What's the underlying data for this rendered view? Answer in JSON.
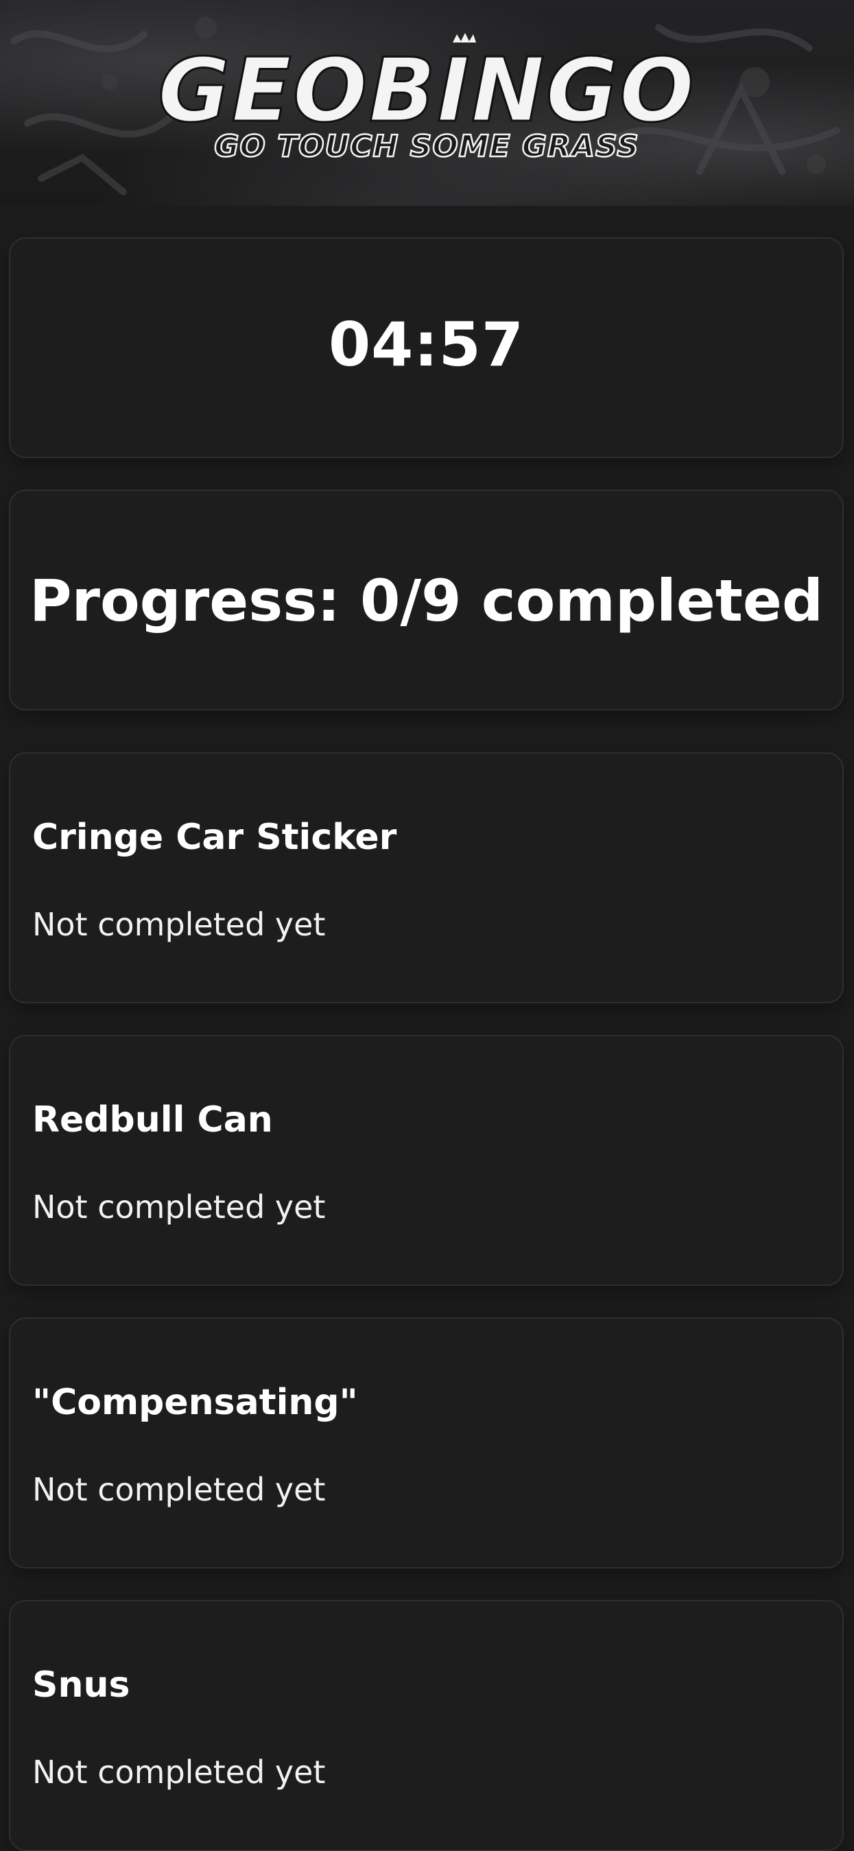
{
  "header": {
    "logo_text": "GEOBINGO",
    "tagline": "GO TOUCH SOME GRASS"
  },
  "timer": {
    "value": "04:57"
  },
  "progress": {
    "label": "Progress: 0/9 completed",
    "completed": 0,
    "total": 9
  },
  "items": [
    {
      "title": "Cringe Car Sticker",
      "status": "Not completed yet"
    },
    {
      "title": "Redbull Can",
      "status": "Not completed yet"
    },
    {
      "title": "\"Compensating\"",
      "status": "Not completed yet"
    },
    {
      "title": "Snus",
      "status": "Not completed yet"
    }
  ],
  "colors": {
    "background": "#1c1c1d",
    "card": "#1d1d1e",
    "card_border": "#2e2e30",
    "text": "#ffffff"
  }
}
